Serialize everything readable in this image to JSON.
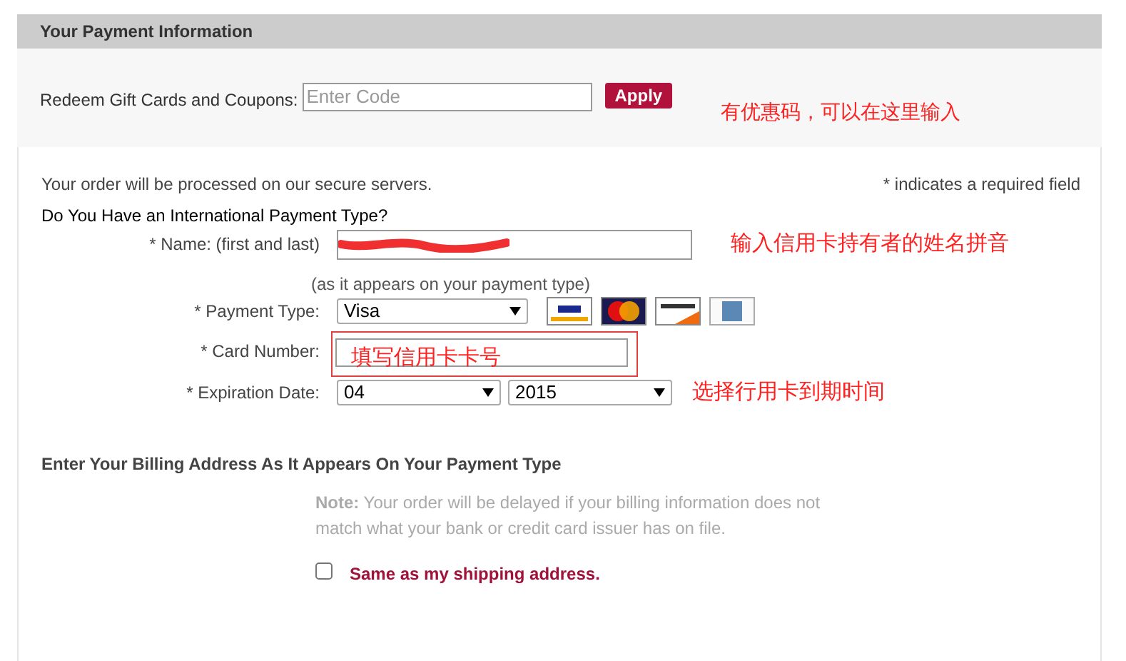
{
  "panel": {
    "title": "Your Payment Information"
  },
  "gift": {
    "label": "Redeem Gift Cards and Coupons:",
    "placeholder": "Enter Code",
    "button": "Apply",
    "annotation": "有优惠码，可以在这里输入"
  },
  "intro": {
    "secure_note": "Your order will be processed on our secure servers.",
    "required_note": "* indicates a required field",
    "question": "Do You Have an International Payment Type?"
  },
  "name_row": {
    "label": "* Name: (first and last)",
    "hint": "(as it appears on your payment type)",
    "annotation": "输入信用卡持有者的姓名拼音"
  },
  "payment_row": {
    "label": "* Payment Type:",
    "value": "Visa",
    "cards": [
      {
        "kind": "visa"
      },
      {
        "kind": "mastercard"
      },
      {
        "kind": "discover"
      },
      {
        "kind": "amex"
      }
    ]
  },
  "card_row": {
    "label": "* Card Number:",
    "annotation": "填写信用卡卡号"
  },
  "expiry_row": {
    "label": "* Expiration Date:",
    "month": "04",
    "year": "2015",
    "annotation": "选择行用卡到期时间"
  },
  "billing": {
    "heading": "Enter Your Billing Address As It Appears On Your Payment Type",
    "note": "**Note:** Your order will be delayed if your billing information does not match what your bank or credit card issuer has on file.",
    "same_as_shipping": {
      "label": "Same as my shipping address.",
      "checked": false
    }
  }
}
